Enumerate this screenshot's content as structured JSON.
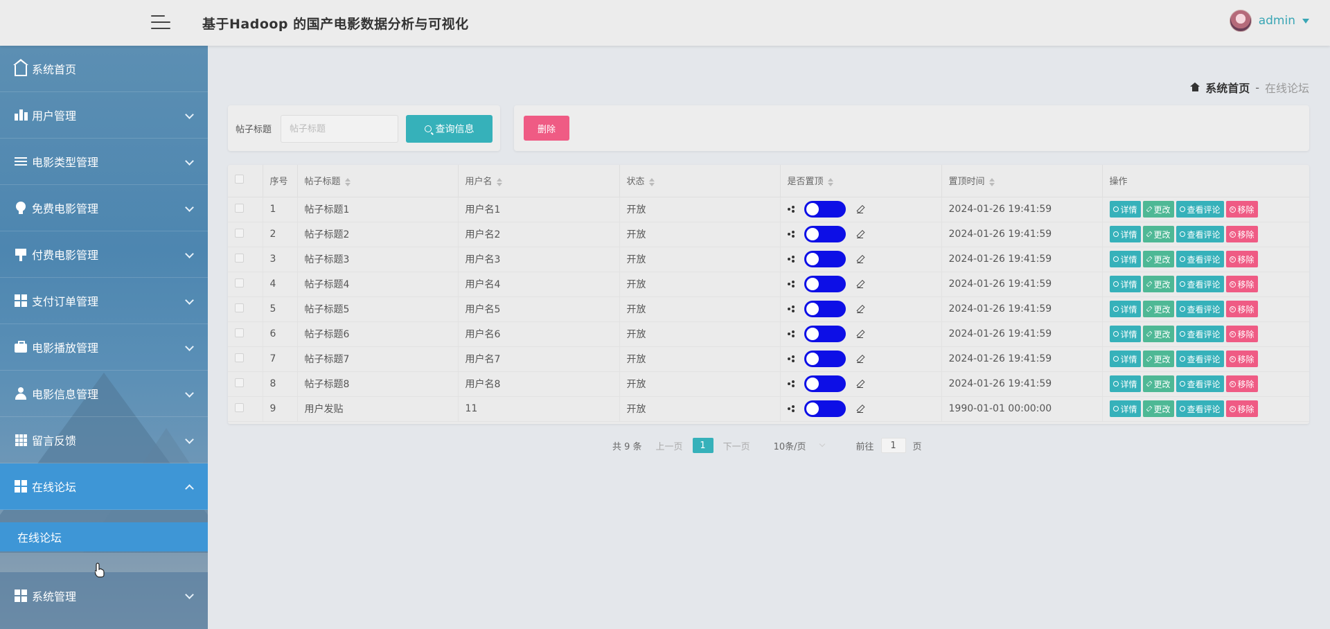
{
  "header": {
    "title": "基于Hadoop 的国产电影数据分析与可视化",
    "user": "admin"
  },
  "sidebar": {
    "items": [
      {
        "label": "系统首页",
        "icon": "home-icon"
      },
      {
        "label": "用户管理",
        "icon": "bar-chart-icon"
      },
      {
        "label": "电影类型管理",
        "icon": "list-icon"
      },
      {
        "label": "免费电影管理",
        "icon": "bulb-icon"
      },
      {
        "label": "付费电影管理",
        "icon": "stamp-icon"
      },
      {
        "label": "支付订单管理",
        "icon": "grid-icon"
      },
      {
        "label": "电影播放管理",
        "icon": "briefcase-icon"
      },
      {
        "label": "电影信息管理",
        "icon": "user-icon"
      },
      {
        "label": "留言反馈",
        "icon": "grid9-icon"
      },
      {
        "label": "在线论坛",
        "icon": "grid-icon"
      },
      {
        "label": "系统管理",
        "icon": "grid-icon"
      }
    ],
    "active_sub": "在线论坛"
  },
  "breadcrumb": {
    "home": "系统首页",
    "sep": "-",
    "current": "在线论坛"
  },
  "search": {
    "label": "帖子标题",
    "placeholder": "帖子标题",
    "button": "查询信息"
  },
  "actions": {
    "delete": "删除"
  },
  "table": {
    "headers": [
      "序号",
      "帖子标题",
      "用户名",
      "状态",
      "是否置顶",
      "置顶时间",
      "操作"
    ],
    "op_labels": {
      "detail": "详情",
      "edit": "更改",
      "comment": "查看评论",
      "remove": "移除"
    },
    "rows": [
      {
        "no": "1",
        "title": "帖子标题1",
        "user": "用户名1",
        "status": "开放",
        "time": "2024-01-26 19:41:59"
      },
      {
        "no": "2",
        "title": "帖子标题2",
        "user": "用户名2",
        "status": "开放",
        "time": "2024-01-26 19:41:59"
      },
      {
        "no": "3",
        "title": "帖子标题3",
        "user": "用户名3",
        "status": "开放",
        "time": "2024-01-26 19:41:59"
      },
      {
        "no": "4",
        "title": "帖子标题4",
        "user": "用户名4",
        "status": "开放",
        "time": "2024-01-26 19:41:59"
      },
      {
        "no": "5",
        "title": "帖子标题5",
        "user": "用户名5",
        "status": "开放",
        "time": "2024-01-26 19:41:59"
      },
      {
        "no": "6",
        "title": "帖子标题6",
        "user": "用户名6",
        "status": "开放",
        "time": "2024-01-26 19:41:59"
      },
      {
        "no": "7",
        "title": "帖子标题7",
        "user": "用户名7",
        "status": "开放",
        "time": "2024-01-26 19:41:59"
      },
      {
        "no": "8",
        "title": "帖子标题8",
        "user": "用户名8",
        "status": "开放",
        "time": "2024-01-26 19:41:59"
      },
      {
        "no": "9",
        "title": "用户发贴",
        "user": "11",
        "status": "开放",
        "time": "1990-01-01 00:00:00"
      }
    ]
  },
  "pagination": {
    "total": "共 9 条",
    "prev": "上一页",
    "page": "1",
    "next": "下一页",
    "size": "10条/页",
    "goto": "前往",
    "goto_value": "1",
    "page_unit": "页"
  },
  "colors": {
    "accent": "#36b1ba",
    "danger": "#ef5b84",
    "edit": "#4eb895",
    "toggle": "#0d0fe6",
    "sidebar_active": "#3e96d6"
  }
}
